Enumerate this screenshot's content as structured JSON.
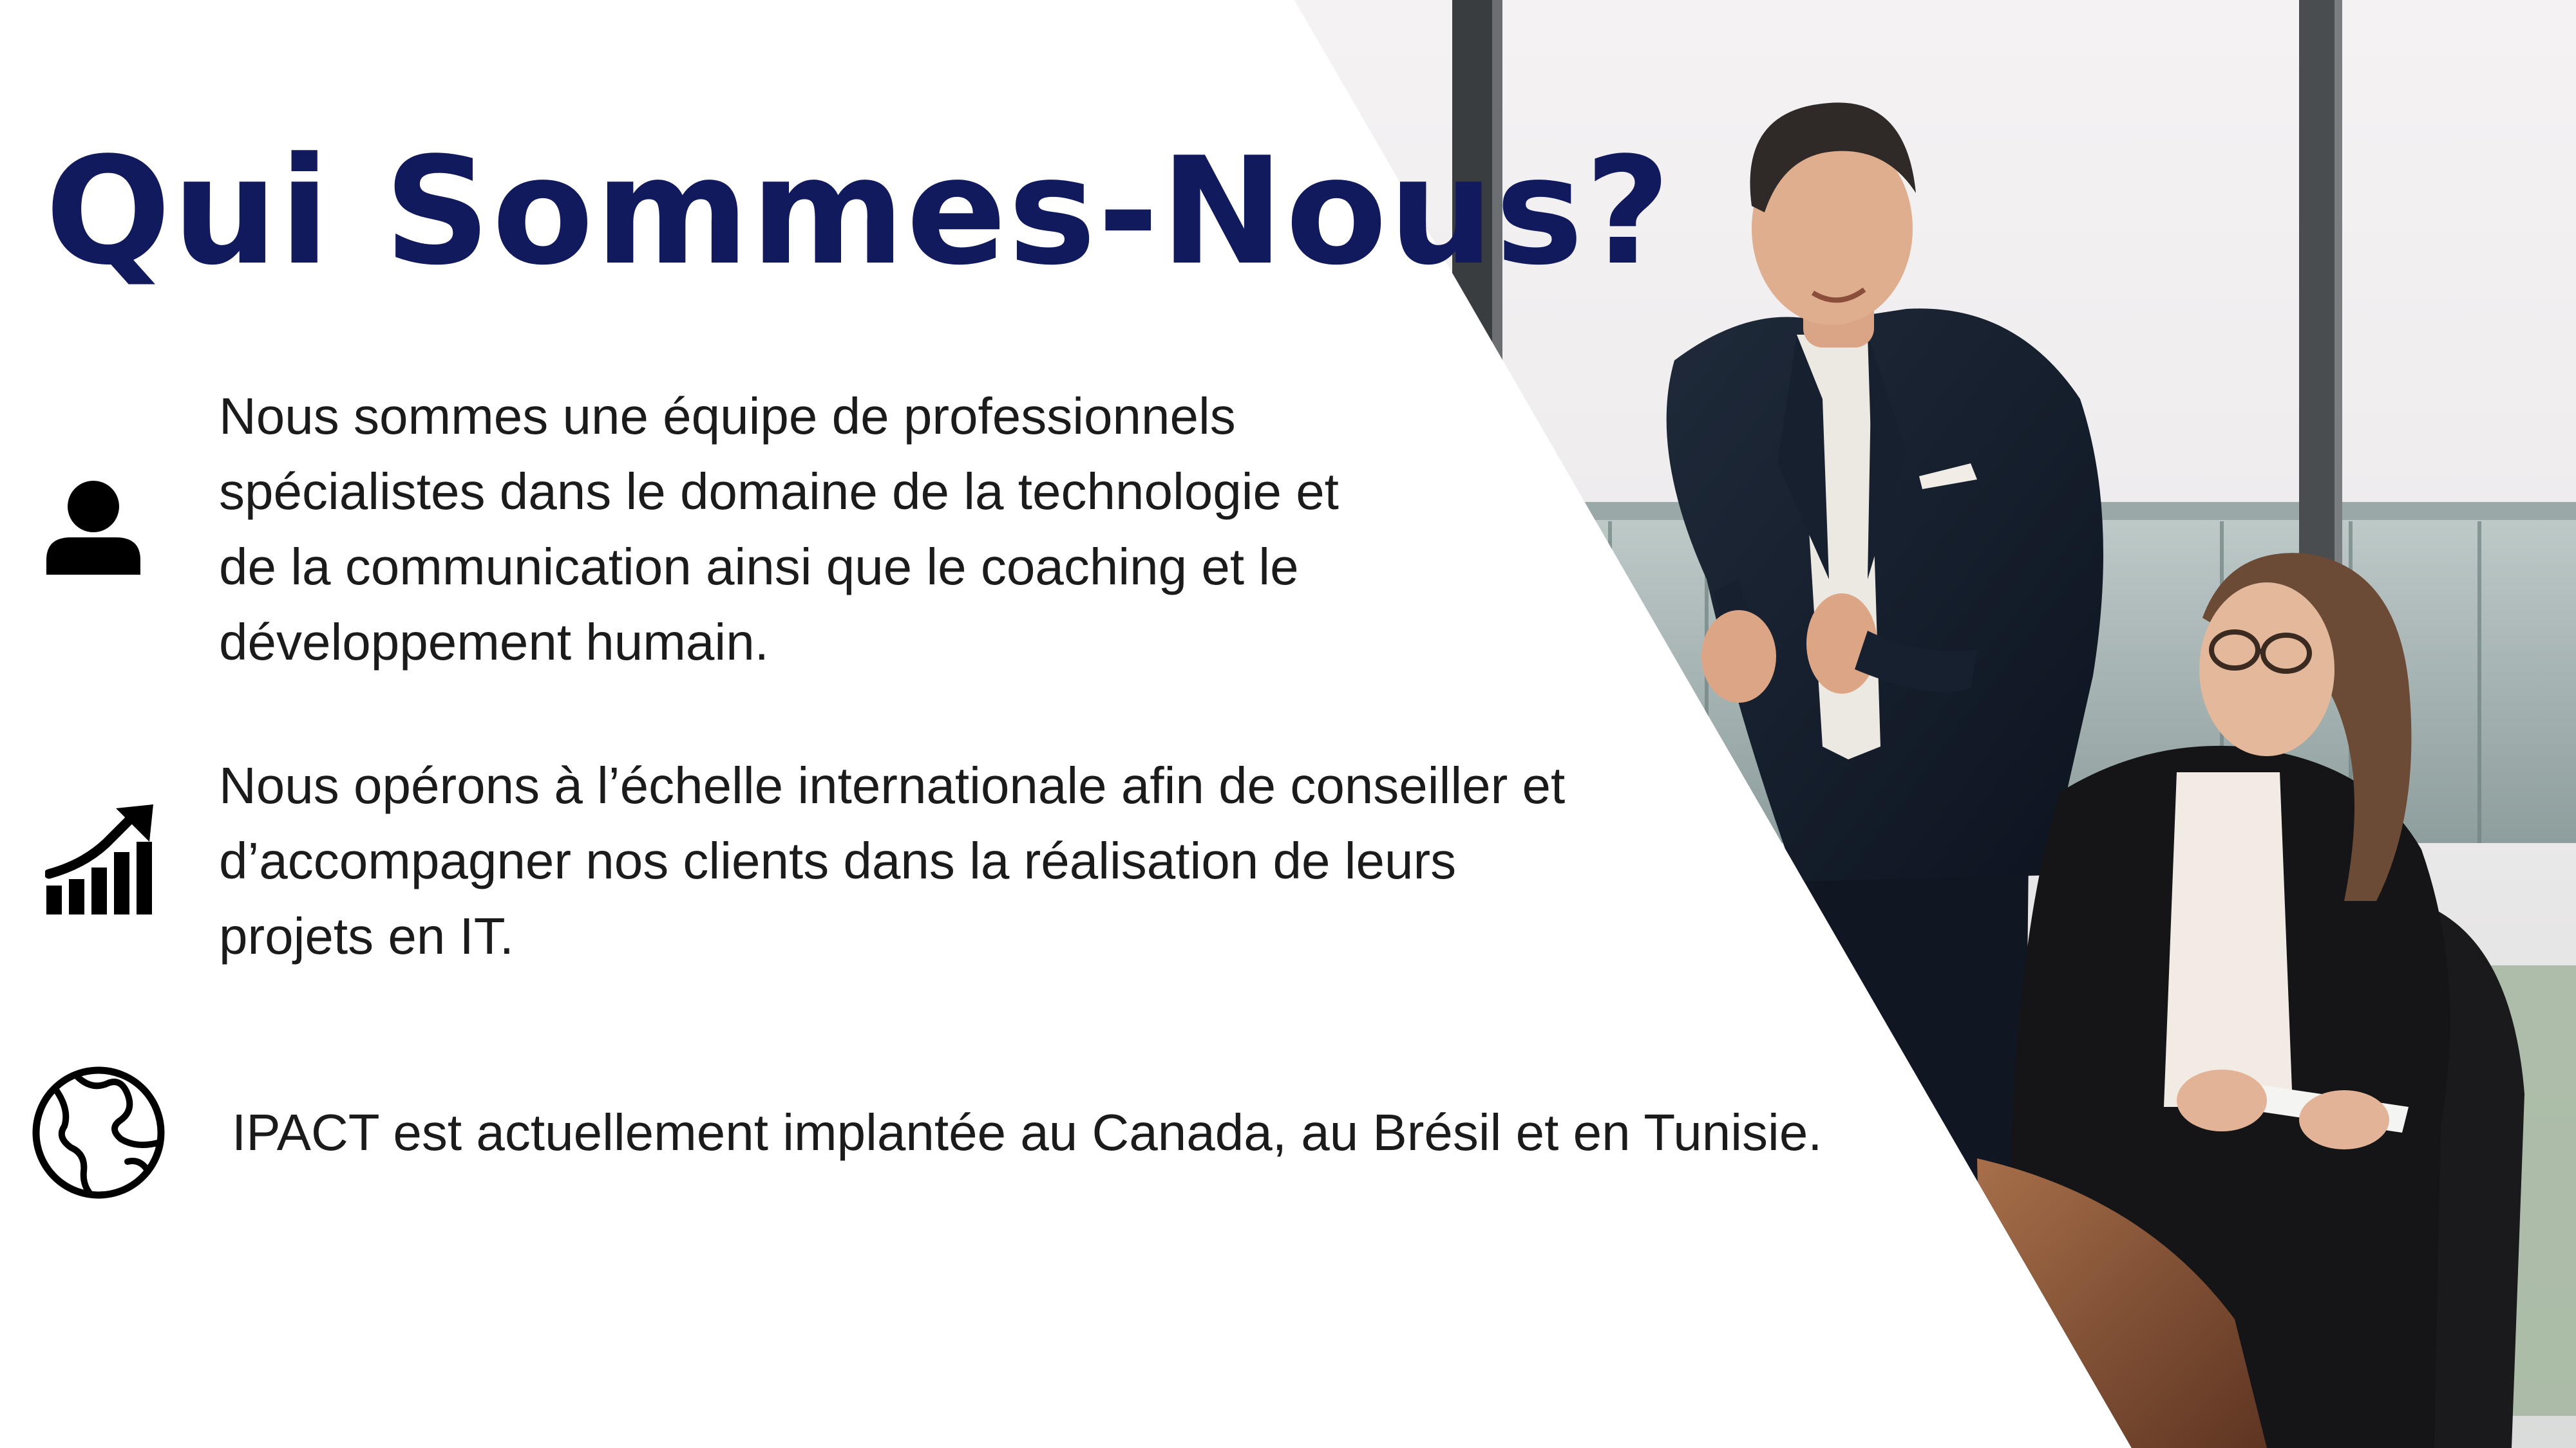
{
  "title": "Qui Sommes-Nous?",
  "items": [
    {
      "icon": "person-icon",
      "lines": [
        "Nous sommes une équipe de professionnels",
        "spécialistes dans le domaine de la technologie et",
        "de la communication ainsi que le coaching et le",
        "développement humain."
      ]
    },
    {
      "icon": "growth-chart-icon",
      "lines": [
        "Nous opérons à l’échelle internationale afin de conseiller et",
        "d’accompagner nos clients dans la réalisation de leurs",
        "projets en IT."
      ]
    },
    {
      "icon": "globe-icon",
      "lines": [
        "IPACT est actuellement implantée au Canada, au Brésil et en Tunisie."
      ]
    }
  ],
  "colors": {
    "title": "#121a5e",
    "text": "#1b1b1b",
    "background": "#ffffff"
  }
}
